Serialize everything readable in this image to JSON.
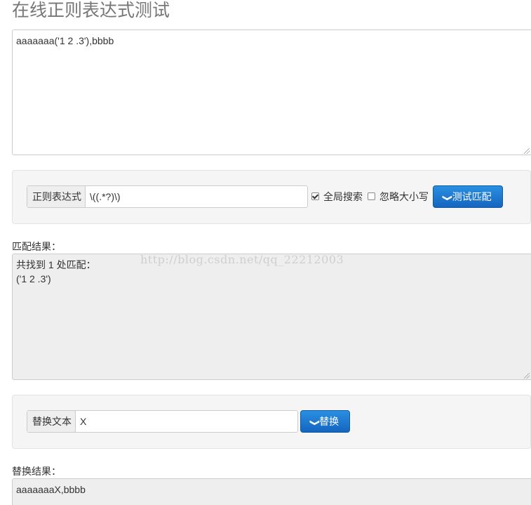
{
  "page": {
    "title": "在线正则表达式测试"
  },
  "source": {
    "text": "aaaaaaa('1 2 .3'),bbbb"
  },
  "regex": {
    "addon_label": "正则表达式",
    "value": "\\((.*?)\\)",
    "global_label": "全局搜索",
    "global_checked": true,
    "ignore_case_label": "忽略大小写",
    "ignore_case_checked": false,
    "test_button_label": "测试匹配"
  },
  "match": {
    "section_label": "匹配结果：",
    "result_text": "共找到 1 处匹配：\n('1 2 .3')"
  },
  "replace": {
    "addon_label": "替换文本",
    "value": "X",
    "button_label": "替换",
    "section_label": "替换结果：",
    "result_text": "aaaaaaaX,bbbb"
  },
  "watermark": {
    "text": "http://blog.csdn.net/qq_22212003"
  },
  "colors": {
    "button": "#1a72cc",
    "panel_bg": "#f5f5f5",
    "result_bg": "#eeeeee"
  }
}
